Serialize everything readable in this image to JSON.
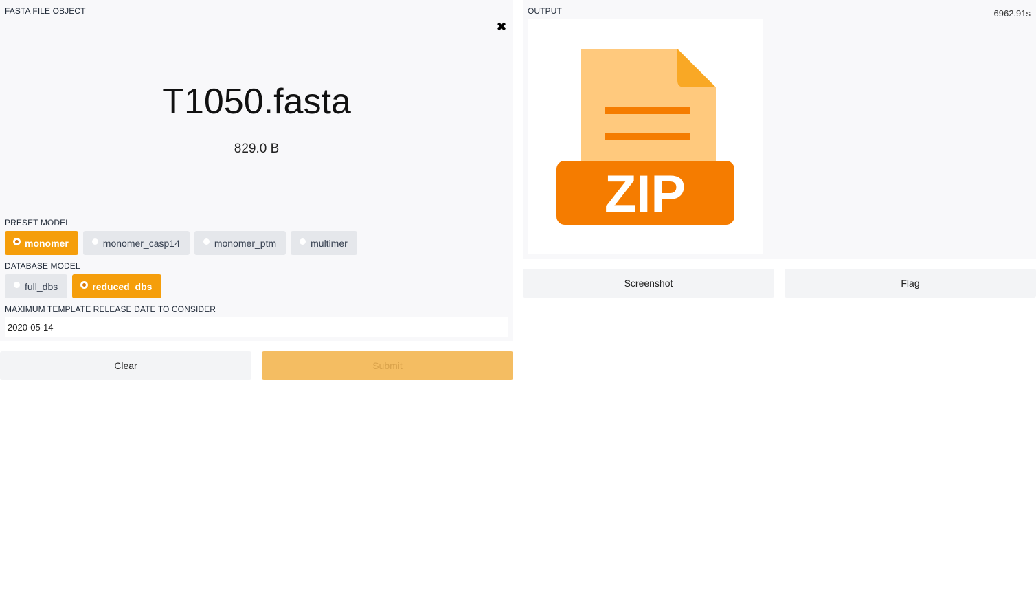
{
  "input": {
    "file_label": "FASTA FILE OBJECT",
    "file_name": "T1050.fasta",
    "file_size": "829.0 B",
    "preset_label": "PRESET MODEL",
    "preset_options": [
      "monomer",
      "monomer_casp14",
      "monomer_ptm",
      "multimer"
    ],
    "preset_selected": "monomer",
    "database_label": "DATABASE MODEL",
    "database_options": [
      "full_dbs",
      "reduced_dbs"
    ],
    "database_selected": "reduced_dbs",
    "date_label": "MAXIMUM TEMPLATE RELEASE DATE TO CONSIDER",
    "date_value": "2020-05-14"
  },
  "actions": {
    "clear_label": "Clear",
    "submit_label": "Submit"
  },
  "output": {
    "label": "OUTPUT",
    "timer": "6962.91s",
    "file_icon": "zip-file-icon",
    "zip_text": "ZIP",
    "screenshot_label": "Screenshot",
    "flag_label": "Flag"
  },
  "colors": {
    "accent": "#f59e0b",
    "zip_orange": "#f57c00",
    "zip_light": "#ffc97d"
  }
}
